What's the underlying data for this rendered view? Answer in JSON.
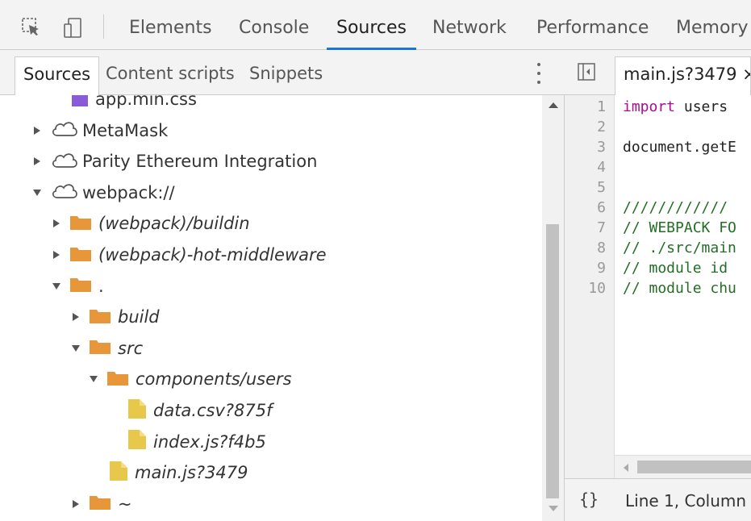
{
  "toolbar": {
    "icons": [
      "inspect-element-icon",
      "device-toolbar-icon"
    ],
    "tabs": [
      "Elements",
      "Console",
      "Sources",
      "Network",
      "Performance",
      "Memory"
    ],
    "active_tab": "Sources",
    "accent_color": "#1a73e8"
  },
  "navigator": {
    "tabs": [
      "Sources",
      "Content scripts",
      "Snippets"
    ],
    "active_tab": "Sources",
    "tree": [
      {
        "label": "app.min.css",
        "icon": "css-file-icon",
        "expanded": null,
        "italic": false
      },
      {
        "label": "MetaMask",
        "icon": "cloud-icon",
        "expanded": false,
        "italic": false
      },
      {
        "label": "Parity Ethereum Integration",
        "icon": "cloud-icon",
        "expanded": false,
        "italic": false
      },
      {
        "label": "webpack://",
        "icon": "cloud-icon",
        "expanded": true,
        "italic": false
      },
      {
        "label": "(webpack)/buildin",
        "icon": "folder-icon",
        "expanded": false,
        "italic": true
      },
      {
        "label": "(webpack)-hot-middleware",
        "icon": "folder-icon",
        "expanded": false,
        "italic": true
      },
      {
        "label": ".",
        "icon": "folder-icon",
        "expanded": true,
        "italic": false
      },
      {
        "label": "build",
        "icon": "folder-icon",
        "expanded": false,
        "italic": true
      },
      {
        "label": "src",
        "icon": "folder-icon",
        "expanded": true,
        "italic": true
      },
      {
        "label": "components/users",
        "icon": "folder-icon",
        "expanded": true,
        "italic": true
      },
      {
        "label": "data.csv?875f",
        "icon": "file-icon",
        "expanded": null,
        "italic": true
      },
      {
        "label": "index.js?f4b5",
        "icon": "file-icon",
        "expanded": null,
        "italic": true
      },
      {
        "label": "main.js?3479",
        "icon": "file-icon",
        "expanded": null,
        "italic": true
      },
      {
        "label": "~",
        "icon": "folder-icon",
        "expanded": false,
        "italic": false
      }
    ],
    "colors": {
      "folder": "#e8963a",
      "file": "#e8c84a",
      "css_file": "#8b5ad8"
    }
  },
  "editor": {
    "tab_label": "main.js?3479 ×",
    "line_numbers": [
      "1",
      "2",
      "3",
      "4",
      "5",
      "6",
      "7",
      "8",
      "9",
      "10"
    ],
    "lines": [
      {
        "keyword": "import",
        "text": " users"
      },
      {
        "keyword": "",
        "text": ""
      },
      {
        "keyword": "",
        "text": "document.getE"
      },
      {
        "keyword": "",
        "text": ""
      },
      {
        "keyword": "",
        "text": ""
      },
      {
        "keyword": "",
        "text": "////////////"
      },
      {
        "keyword": "",
        "text": "// WEBPACK FO"
      },
      {
        "keyword": "",
        "text": "// ./src/main"
      },
      {
        "keyword": "",
        "text": "// module id"
      },
      {
        "keyword": "",
        "text": "// module chu"
      }
    ],
    "comment_color": "#236e25",
    "keyword_color": "#a90d91",
    "status": {
      "pretty_print": "{}",
      "cursor": "Line 1, Column"
    }
  }
}
